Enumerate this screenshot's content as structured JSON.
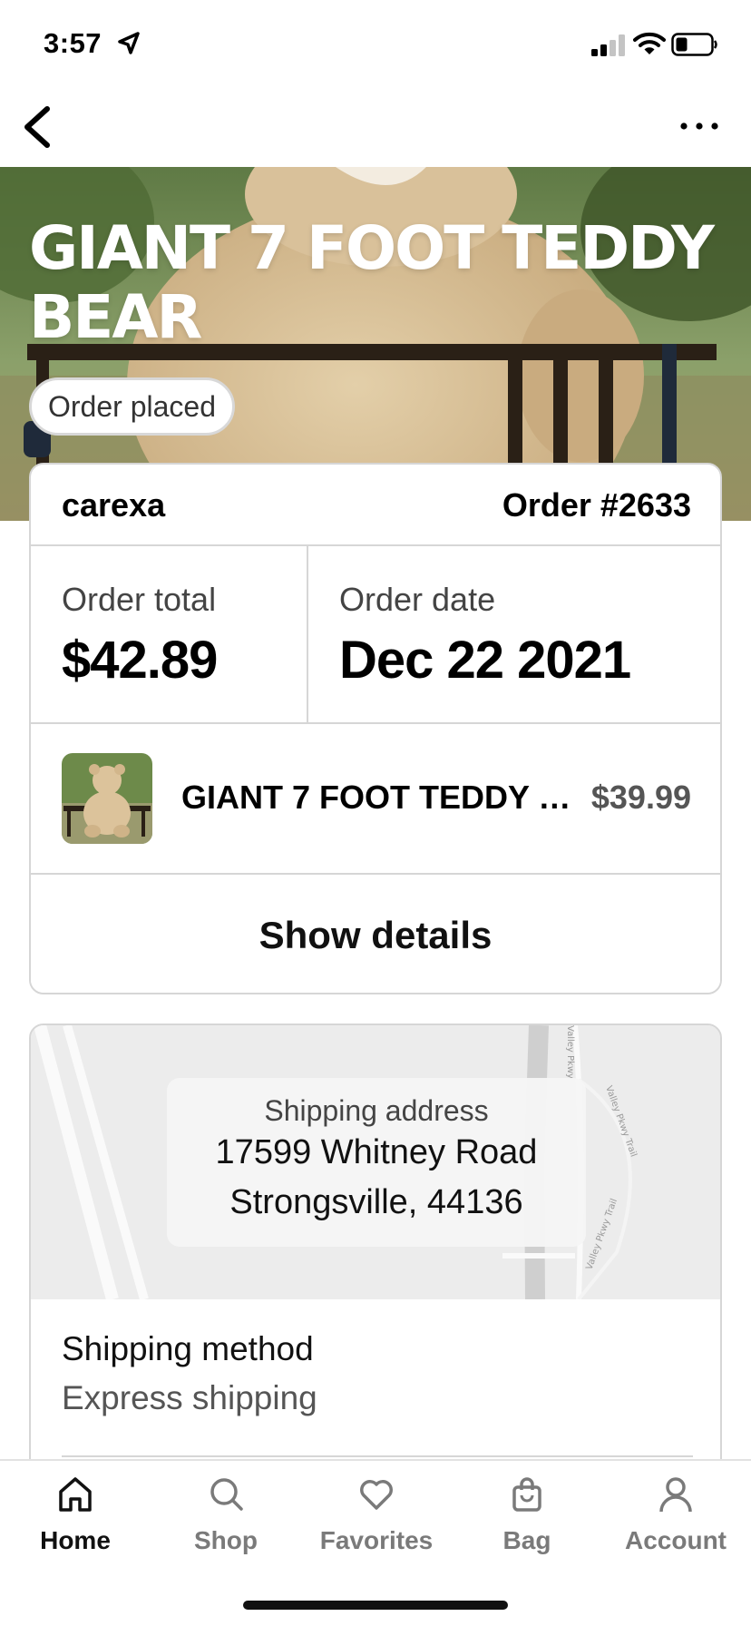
{
  "status_bar": {
    "time": "3:57",
    "icons": [
      "location-arrow-icon",
      "cellular-signal-icon",
      "wifi-icon",
      "battery-icon"
    ]
  },
  "nav": {
    "back_icon": "chevron-left-icon",
    "more_icon": "more-dots-icon"
  },
  "hero": {
    "title": "GIANT 7 FOOT TEDDY BEAR",
    "status": "Order placed"
  },
  "order": {
    "shop_name": "carexa",
    "order_number": "Order #2633",
    "total_label": "Order total",
    "total_value": "$42.89",
    "date_label": "Order date",
    "date_value": "Dec 22 2021",
    "item": {
      "name": "GIANT 7 FOOT TEDDY BEAR",
      "price": "$39.99"
    },
    "show_details_label": "Show details"
  },
  "shipping": {
    "address_label": "Shipping address",
    "address_line1": "17599 Whitney Road",
    "address_line2": "Strongsville, 44136",
    "map_labels": [
      "Valley Pkwy",
      "Valley Pkwy Trail",
      "Valley Pkwy Trail",
      "Valley Pkwy"
    ],
    "method_title": "Shipping method",
    "method_value": "Express shipping"
  },
  "tabs": [
    {
      "label": "Home",
      "icon": "home-icon",
      "active": true
    },
    {
      "label": "Shop",
      "icon": "search-icon",
      "active": false
    },
    {
      "label": "Favorites",
      "icon": "heart-icon",
      "active": false
    },
    {
      "label": "Bag",
      "icon": "bag-icon",
      "active": false
    },
    {
      "label": "Account",
      "icon": "account-icon",
      "active": false
    }
  ],
  "colors": {
    "text_primary": "#111111",
    "text_secondary": "#555555",
    "border": "#d6d6d6",
    "tab_inactive": "#7a7a7a"
  }
}
